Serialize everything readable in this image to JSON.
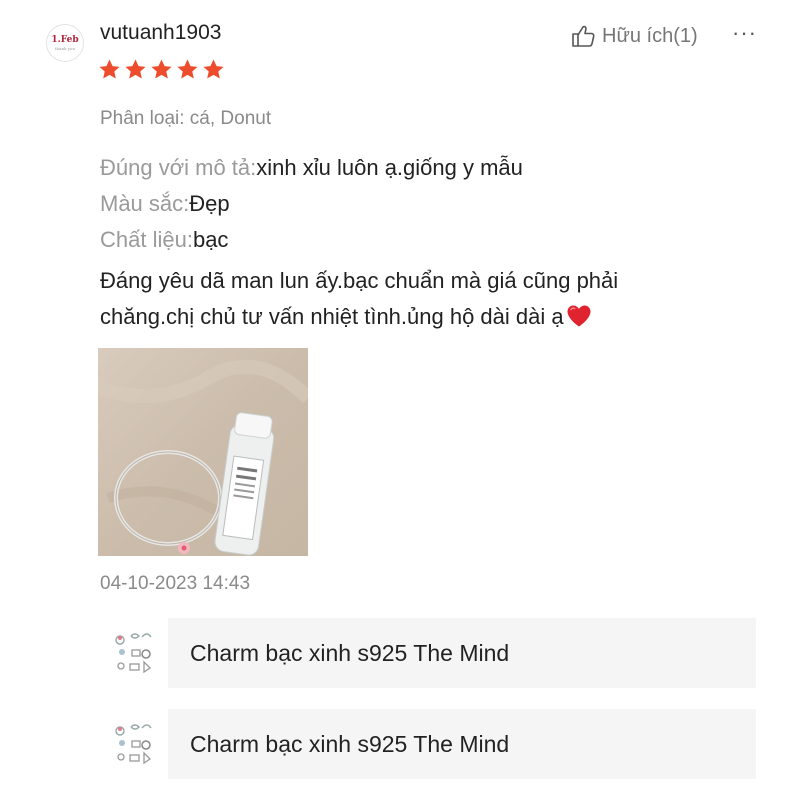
{
  "review": {
    "username": "vutuanh1903",
    "avatar_text": "1.Feb",
    "avatar_subtext": "thank you",
    "rating": 5,
    "star_color": "#ee4d2d",
    "helpful_label": "Hữu ích",
    "helpful_count": "(1)",
    "more_label": "···",
    "variation": "Phân loại: cá, Donut",
    "attributes": [
      {
        "key": "Đúng với mô tả:",
        "value": "xinh xỉu luôn ạ.giống y mẫu"
      },
      {
        "key": "Màu sắc:",
        "value": "Đẹp"
      },
      {
        "key": "Chất liệu:",
        "value": "bạc"
      }
    ],
    "comment_line1": "Đáng yêu dã man lun ấy.bạc chuẩn mà giá cũng phải",
    "comment_line2": "chăng.chị chủ tư vấn nhiệt tình.ủng hộ dài dài ạ",
    "timestamp": "04-10-2023 14:43"
  },
  "products": [
    {
      "name": "Charm bạc xinh s925 The Mind"
    },
    {
      "name": "Charm bạc xinh s925 The Mind"
    }
  ]
}
